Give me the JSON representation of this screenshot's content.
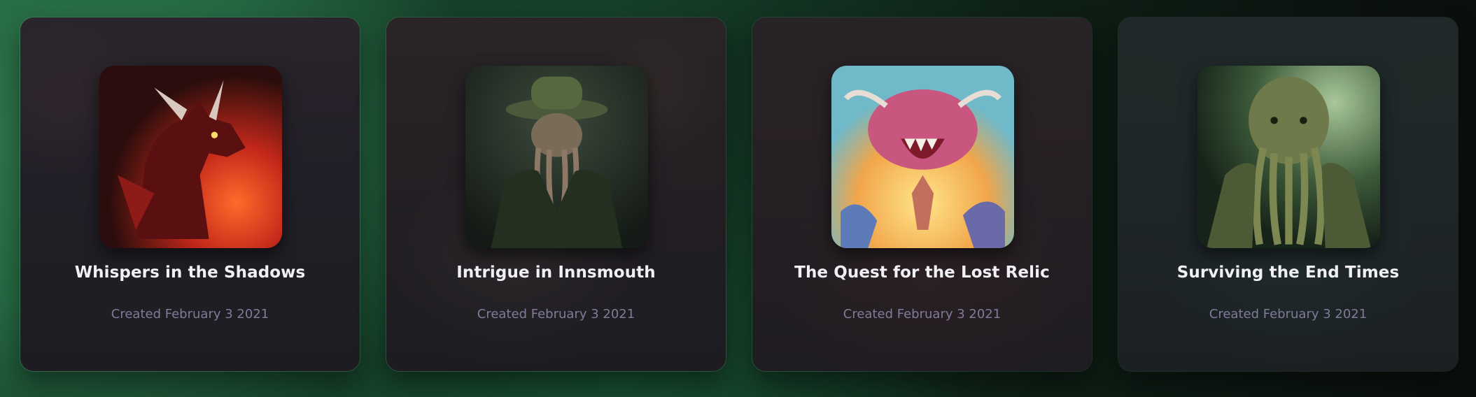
{
  "cards": [
    {
      "title": "Whispers in the Shadows",
      "created": "Created February 3 2021",
      "image": "red-dragon"
    },
    {
      "title": "Intrigue in Innsmouth",
      "created": "Created February 3 2021",
      "image": "tentacled-man-in-hat"
    },
    {
      "title": "The Quest for the Lost Relic",
      "created": "Created February 3 2021",
      "image": "pink-dragon-battle"
    },
    {
      "title": "Surviving the End Times",
      "created": "Created February 3 2021",
      "image": "cthulhu-green"
    }
  ]
}
